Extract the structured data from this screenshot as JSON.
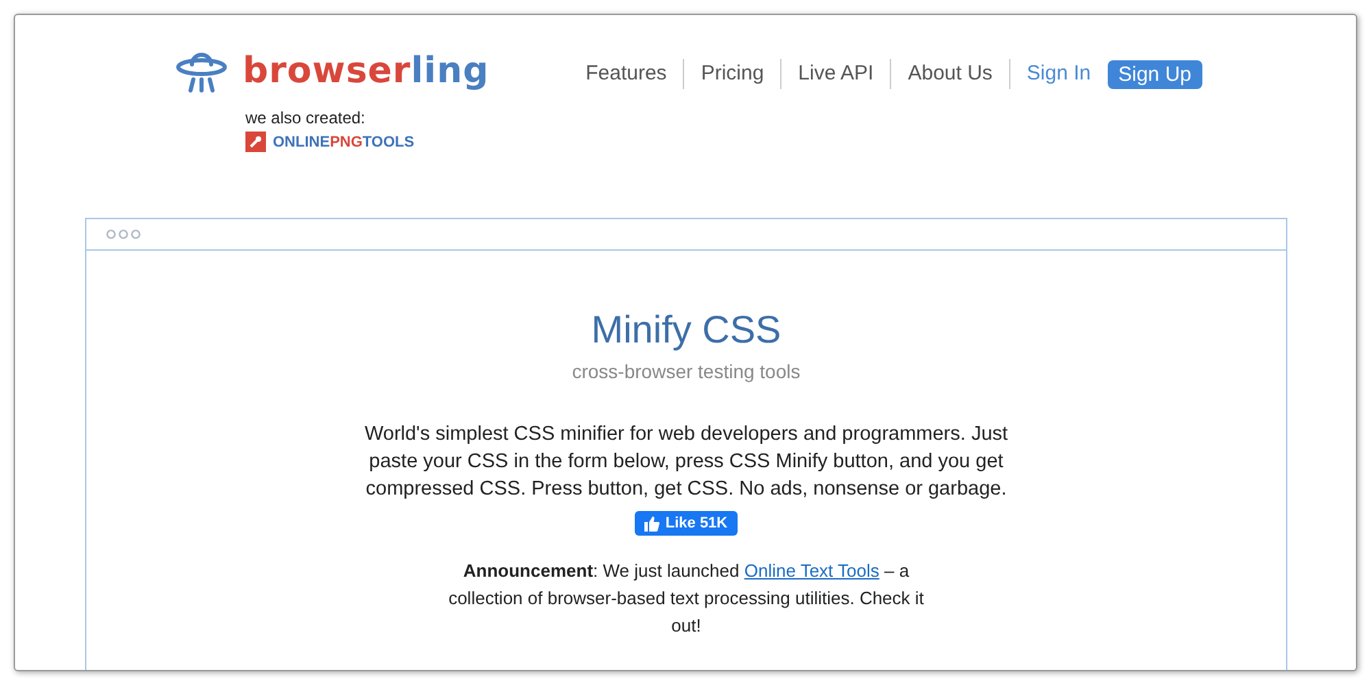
{
  "logo": {
    "parts": [
      {
        "text": "browser",
        "color": "#d9473b"
      },
      {
        "text": "ling",
        "color": "#4a7fc1"
      }
    ]
  },
  "also_created": {
    "label": "we also created:",
    "parts": [
      {
        "text": "ONLINE",
        "color": "#3d73b9"
      },
      {
        "text": "PNG",
        "color": "#d9473b"
      },
      {
        "text": "TOOLS",
        "color": "#3d73b9"
      }
    ]
  },
  "nav": [
    {
      "label": "Features",
      "kind": "nav"
    },
    {
      "label": "Pricing",
      "kind": "nav"
    },
    {
      "label": "Live API",
      "kind": "nav"
    },
    {
      "label": "About Us",
      "kind": "nav"
    },
    {
      "label": "Sign In",
      "kind": "account"
    },
    {
      "label": "Sign Up",
      "kind": "button"
    }
  ],
  "card": {
    "title": "Minify CSS",
    "subtitle": "cross-browser testing tools",
    "description": "World's simplest CSS minifier for web developers and programmers. Just paste your CSS in the form below, press CSS Minify button, and you get compressed CSS. Press button, get CSS. No ads, nonsense or garbage.",
    "like": "Like 51K",
    "announcement": {
      "before": "**Announcement**: We just launched ",
      "link": "Online Text Tools",
      "after": " – a collection of browser-based text processing utilities. Check it out!"
    }
  }
}
